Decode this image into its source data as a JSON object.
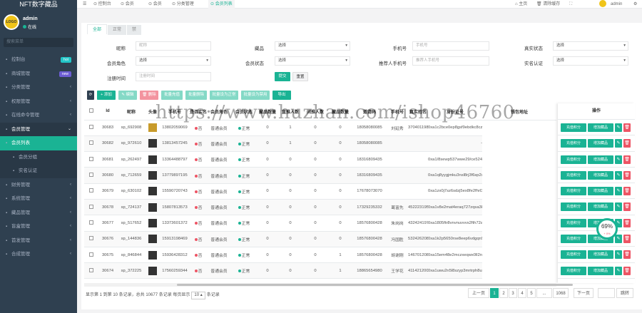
{
  "sidebar": {
    "brand": "NFT数字藏品",
    "user": {
      "name": "admin",
      "status": "在线",
      "avatar_text": "LOGO"
    },
    "search_placeholder": "搜索菜单",
    "items": [
      {
        "label": "控制台",
        "icon": "dashboard-icon",
        "badge": "hot",
        "badge_color": "#23c6c8"
      },
      {
        "label": "商城管理",
        "icon": "shop-icon",
        "badge": "new",
        "badge_color": "#6c5dd3"
      },
      {
        "label": "分类管理",
        "icon": "list-icon"
      },
      {
        "label": "权限管理",
        "icon": "lock-icon"
      },
      {
        "label": "在线命令管理",
        "icon": "terminal-icon"
      },
      {
        "label": "会员管理",
        "icon": "user-icon",
        "open": true
      },
      {
        "label": "会员列表",
        "icon": "user-list-icon",
        "active": true
      },
      {
        "label": "会员分组",
        "icon": "users-icon",
        "sub": true
      },
      {
        "label": "实名认证",
        "icon": "id-icon",
        "sub": true
      },
      {
        "label": "财务管理",
        "icon": "money-icon"
      },
      {
        "label": "系统管理",
        "icon": "gear-icon"
      },
      {
        "label": "藏品管理",
        "icon": "box-icon"
      },
      {
        "label": "盲盒管理",
        "icon": "gift-icon"
      },
      {
        "label": "首发管理",
        "icon": "flag-icon"
      },
      {
        "label": "合成管理",
        "icon": "merge-icon"
      }
    ]
  },
  "topbar": {
    "tabs": [
      "控制台",
      "会员",
      "会员",
      "分类管理",
      "会员列表"
    ],
    "right": {
      "home": "主页",
      "clear": "清除缓存",
      "user": "admin"
    }
  },
  "panel": {
    "tabs": [
      "全部",
      "正常",
      "禁"
    ]
  },
  "filters": {
    "nickname": {
      "label": "昵称",
      "placeholder": "昵称"
    },
    "status": {
      "label": "藏品",
      "value": "选择"
    },
    "phone": {
      "label": "手机号",
      "placeholder": "手机号"
    },
    "realname_status": {
      "label": "真实状态",
      "value": "选择"
    },
    "role": {
      "label": "会员角色",
      "value": "选择"
    },
    "member_status": {
      "label": "会员状态",
      "value": "选择"
    },
    "inviter_phone": {
      "label": "推荐人手机号",
      "placeholder": "推荐人手机号"
    },
    "verified": {
      "label": "实名认证",
      "value": "选择"
    },
    "regtime": {
      "label": "注册时间",
      "placeholder": "注册时间"
    },
    "submit": "提交",
    "reset": "重置"
  },
  "toolbar": [
    {
      "label": "⟳",
      "color": "#2f4050",
      "w": 10
    },
    {
      "label": "+ 添加",
      "color": "#1ab394",
      "w": 26
    },
    {
      "label": "✎ 编辑",
      "color": "#84d9c6",
      "w": 26
    },
    {
      "label": "🗑 删除",
      "color": "#f3949f",
      "w": 26
    },
    {
      "label": "批量充值",
      "color": "#84d9c6",
      "w": 30
    },
    {
      "label": "批量删除",
      "color": "#84d9c6",
      "w": 30
    },
    {
      "label": "批量设为正常",
      "color": "#84d9c6",
      "w": 40
    },
    {
      "label": "批量设为禁用",
      "color": "#84d9c6",
      "w": 40
    },
    {
      "label": "导出",
      "color": "#1ab394",
      "w": 26
    }
  ],
  "table": {
    "columns": [
      "",
      "Id",
      "昵称",
      "头像",
      "手机号",
      "是否实名",
      "会员角色",
      "会员状态",
      "藏品数量",
      "直推人数",
      "间推人数",
      "藏品数量",
      "邀请码",
      "手机号",
      "真实姓名",
      "身份证号",
      "钱包地址"
    ],
    "rows": [
      {
        "id": "30683",
        "nick": "sp_692908",
        "phone": "13802059069",
        "real": "否",
        "role": "普通会员",
        "status": "正常",
        "a": "0",
        "b": "1",
        "c": "0",
        "d": "0",
        "invite": "18058080085",
        "name": "刘延秀",
        "idno": "37040119870323461",
        "wallet": "0xa1c2bce0ep8gsf9ebdkc8czrp34b"
      },
      {
        "id": "30682",
        "nick": "sp_972610",
        "phone": "13813457245",
        "real": "否",
        "role": "普通会员",
        "status": "正常",
        "a": "0",
        "b": "1",
        "c": "0",
        "d": "0",
        "invite": "18058080085",
        "name": "",
        "idno": "",
        "wallet": "-"
      },
      {
        "id": "30681",
        "nick": "sp_262497",
        "phone": "13364488797",
        "real": "否",
        "role": "普通会员",
        "status": "正常",
        "a": "0",
        "b": "0",
        "c": "0",
        "d": "0",
        "invite": "18316809435",
        "name": "",
        "idno": "",
        "wallet": "0xa1/8sewp537wwe29/ce5249ff0e30"
      },
      {
        "id": "30680",
        "nick": "sp_712659",
        "phone": "13779897195",
        "real": "否",
        "role": "普通会员",
        "status": "正常",
        "a": "0",
        "b": "0",
        "c": "0",
        "d": "0",
        "invite": "18316809435",
        "name": "",
        "idno": "",
        "wallet": "0xa1q8yygjmku3nsl8rj3f6sp2ws"
      },
      {
        "id": "30679",
        "nick": "sp_630102",
        "phone": "15590720743",
        "real": "否",
        "role": "普通会员",
        "status": "正常",
        "a": "0",
        "b": "0",
        "c": "0",
        "d": "0",
        "invite": "17678073070",
        "name": "",
        "idno": "",
        "wallet": "0xa1zx0j7sz6sdzj5ex8fe2fhrl3hmg"
      },
      {
        "id": "30678",
        "nick": "sp_724137",
        "phone": "15807813573",
        "real": "否",
        "role": "普通会员",
        "status": "正常",
        "a": "0",
        "b": "0",
        "c": "0",
        "d": "0",
        "invite": "17329235332",
        "name": "葛富先",
        "idno": "45222319500206253",
        "wallet": "0xa1v8e2mat4eraq727zqsa3kpwm"
      },
      {
        "id": "30677",
        "nick": "sp_517652",
        "phone": "13373601372",
        "real": "否",
        "role": "普通会员",
        "status": "正常",
        "a": "0",
        "b": "0",
        "c": "0",
        "d": "0",
        "invite": "18576800428",
        "name": "朱岗岗",
        "idno": "43242419720605721",
        "wallet": "0xa1805ftr8vnvnuvvvs2fth72a77"
      },
      {
        "id": "30676",
        "nick": "sp_144836",
        "phone": "15913198469",
        "real": "否",
        "role": "普通会员",
        "status": "正常",
        "a": "0",
        "b": "0",
        "c": "0",
        "d": "0",
        "invite": "18576800428",
        "name": "冯国胜",
        "idno": "53242620841218317",
        "wallet": "0xa1k2p5650rse8eep6vdgqn9qh5"
      },
      {
        "id": "30675",
        "nick": "sp_846844",
        "phone": "15936428312",
        "real": "否",
        "role": "普通会员",
        "status": "正常",
        "a": "0",
        "b": "0",
        "c": "0",
        "d": "1",
        "invite": "18576800428",
        "name": "胡谢刚",
        "idno": "14670120800318082",
        "wallet": "0xa15em48e2mczxeqwx0ll2nwsyqz8"
      },
      {
        "id": "30674",
        "nick": "sp_372225",
        "phone": "17560259344",
        "real": "否",
        "role": "普通会员",
        "status": "正常",
        "a": "0",
        "b": "0",
        "c": "0",
        "d": "1",
        "invite": "18865654980",
        "name": "王学花",
        "idno": "41142120040284234",
        "wallet": "0xa1uwu2n5l8szyp3mrtrph8ugg6r"
      }
    ],
    "ops": {
      "header": "操作",
      "recharge": "充值积分",
      "add_points": "增加藏品"
    }
  },
  "pagination": {
    "info_prefix": "显示第 1 到第 10 条记录，总共 10677 条记录 每页显示",
    "per_page": "10",
    "info_suffix": "条记录",
    "prev": "上一页",
    "pages": [
      "1",
      "2",
      "3",
      "4",
      "5",
      "...",
      "1068"
    ],
    "next": "下一页",
    "goto": "跳转"
  },
  "watermark": "https://www.huzhan.com/ishop46760",
  "gauge": {
    "value": "69%",
    "sub": "+ 0%"
  }
}
